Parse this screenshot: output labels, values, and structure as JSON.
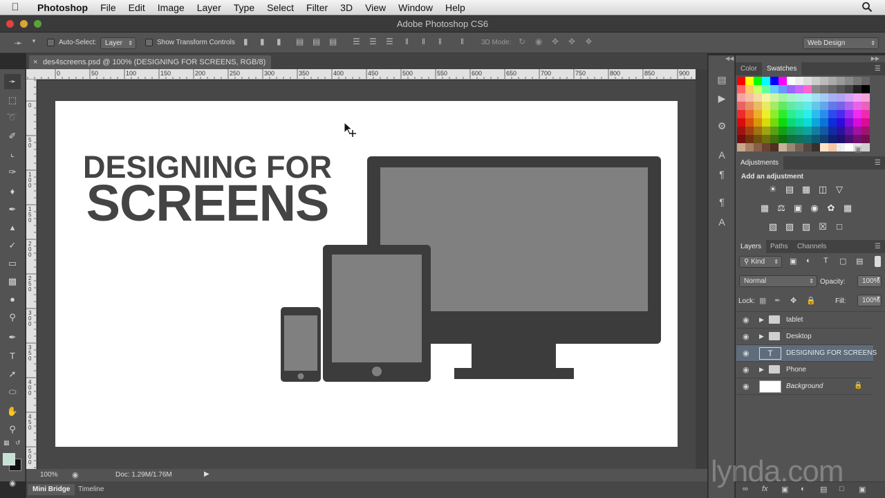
{
  "menubar": {
    "app_name": "Photoshop",
    "items": [
      "File",
      "Edit",
      "Image",
      "Layer",
      "Type",
      "Select",
      "Filter",
      "3D",
      "View",
      "Window",
      "Help"
    ]
  },
  "window": {
    "title": "Adobe Photoshop CS6"
  },
  "options": {
    "auto_select_label": "Auto-Select:",
    "auto_select_value": "Layer",
    "show_transform_label": "Show Transform Controls",
    "mode3d_label": "3D Mode:",
    "workspace": "Web Design"
  },
  "document": {
    "tab_title": "des4screens.psd @ 100% (DESIGNING FOR SCREENS, RGB/8)",
    "ruler_h": [
      "0",
      "50",
      "100",
      "150",
      "200",
      "250",
      "300",
      "350",
      "400",
      "450",
      "500",
      "550",
      "600",
      "650",
      "700",
      "750",
      "800",
      "850",
      "900"
    ],
    "ruler_v": [
      "0",
      "5 0",
      "1 0 0",
      "1 5 0",
      "2 0 0",
      "2 5 0",
      "3 0 0",
      "3 5 0",
      "4 0 0",
      "4 5 0",
      "5 0 0"
    ],
    "heading_line1": "DESIGNING FOR",
    "heading_line2": "SCREENS"
  },
  "status": {
    "zoom": "100%",
    "doc": "Doc: 1.29M/1.76M"
  },
  "bottom_tabs": [
    "Mini Bridge",
    "Timeline"
  ],
  "panels": {
    "color_tabs": [
      "Color",
      "Swatches"
    ],
    "adjustments_tab": "Adjustments",
    "adjustments_hint": "Add an adjustment",
    "layers_tabs": [
      "Layers",
      "Paths",
      "Channels"
    ],
    "kind_label": "Kind",
    "blend_mode": "Normal",
    "opacity_label": "Opacity:",
    "opacity_value": "100%",
    "lock_label": "Lock:",
    "fill_label": "Fill:",
    "fill_value": "100%",
    "layers": [
      {
        "name": "tablet",
        "type": "group"
      },
      {
        "name": "Desktop",
        "type": "group"
      },
      {
        "name": "DESIGNING FOR SCREENS",
        "type": "text",
        "selected": true
      },
      {
        "name": "Phone",
        "type": "group"
      },
      {
        "name": "Background",
        "type": "background"
      }
    ]
  },
  "watermark": "lynda.com",
  "colors": {
    "device_dark": "#3c3c3c",
    "screen_gray": "#808080",
    "heading_text": "#444444",
    "foreground_swatch": "#c5e3d5",
    "background_swatch": "#111111"
  }
}
